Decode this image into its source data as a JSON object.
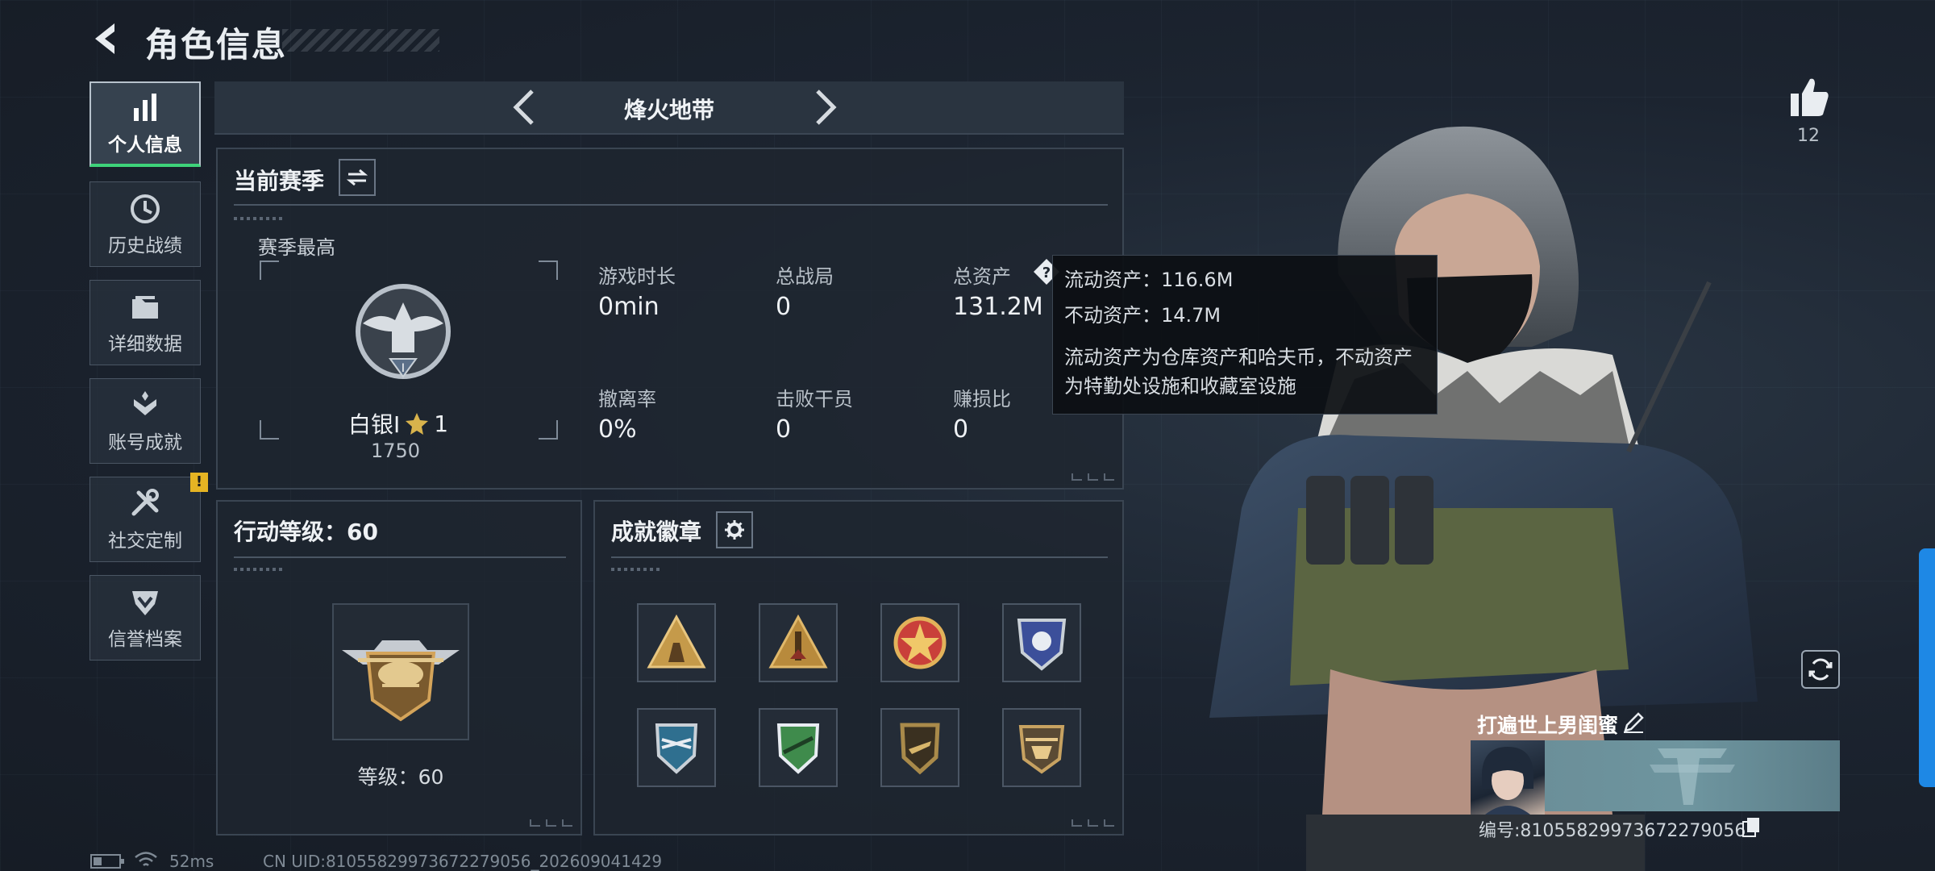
{
  "header": {
    "title": "角色信息"
  },
  "sidebar": {
    "items": [
      {
        "label": "个人信息",
        "icon": "bar-chart-icon",
        "active": true
      },
      {
        "label": "历史战绩",
        "icon": "clock-icon"
      },
      {
        "label": "详细数据",
        "icon": "folder-icon"
      },
      {
        "label": "账号成就",
        "icon": "achievement-icon"
      },
      {
        "label": "社交定制",
        "icon": "tools-icon",
        "alert": "!"
      },
      {
        "label": "信誉档案",
        "icon": "shield-check-icon"
      }
    ]
  },
  "mode": {
    "title": "烽火地带"
  },
  "season": {
    "title": "当前赛季",
    "best_label": "赛季最高",
    "rank": "白银I",
    "rank_stars": "1",
    "rank_points": "1750",
    "stats": [
      {
        "label": "游戏时长",
        "value": "0min"
      },
      {
        "label": "总战局",
        "value": "0"
      },
      {
        "label": "总资产",
        "value": "131.2M"
      },
      {
        "label": "撤离率",
        "value": "0%"
      },
      {
        "label": "击败干员",
        "value": "0"
      },
      {
        "label": "赚损比",
        "value": "0"
      }
    ]
  },
  "tooltip": {
    "line1": "流动资产：116.6M",
    "line2": "不动资产：14.7M",
    "desc1": "流动资产为仓库资产和哈夫币，不动资产",
    "desc2": "为特勤处设施和收藏室设施"
  },
  "level": {
    "title": "行动等级：60",
    "label": "等级：60"
  },
  "achievements": {
    "title": "成就徽章",
    "badges": [
      {
        "icon": "triangle-soldiers-badge-icon",
        "color": "#c59a4a"
      },
      {
        "icon": "triangle-rocket-badge-icon",
        "color": "#b88a3c"
      },
      {
        "icon": "star-emblem-badge-icon",
        "color": "#c9403a"
      },
      {
        "icon": "blue-shield-badge-icon",
        "color": "#3c4f9a"
      },
      {
        "icon": "blue-wings-badge-icon",
        "color": "#2f6f8f"
      },
      {
        "icon": "green-rifle-badge-icon",
        "color": "#3f8b4c"
      },
      {
        "icon": "gold-gun-badge-icon",
        "color": "#a98a4a"
      },
      {
        "icon": "gold-heli-badge-icon",
        "color": "#c7a261"
      }
    ]
  },
  "profile": {
    "likes": "12",
    "name": "打遍世上男闺蜜",
    "id_text": "编号:81055829973672279056"
  },
  "status_bar": {
    "ping": "52ms",
    "uid": "CN UID:81055829973672279056_202609041429"
  }
}
